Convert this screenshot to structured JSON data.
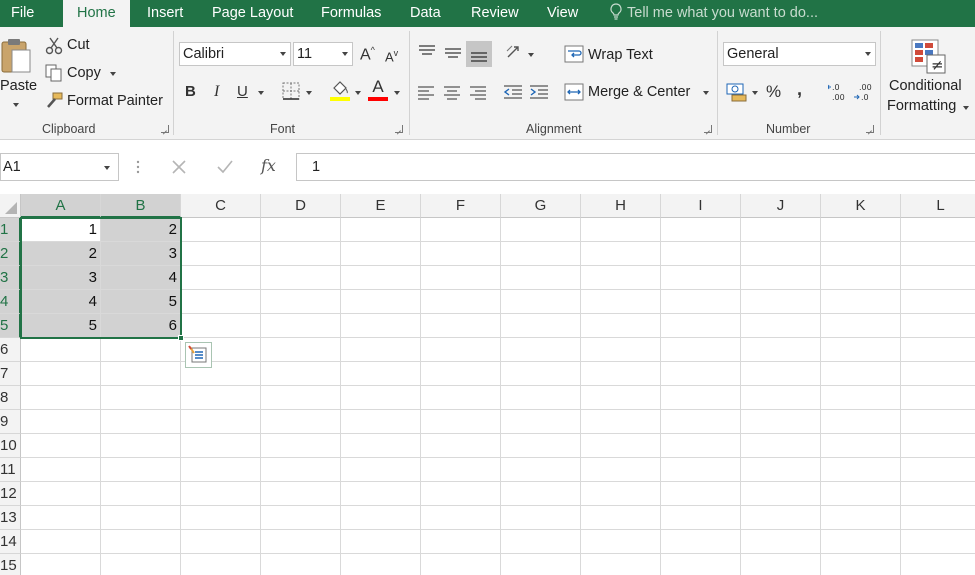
{
  "tabs": [
    {
      "label": "File"
    },
    {
      "label": "Home"
    },
    {
      "label": "Insert"
    },
    {
      "label": "Page Layout"
    },
    {
      "label": "Formulas"
    },
    {
      "label": "Data"
    },
    {
      "label": "Review"
    },
    {
      "label": "View"
    }
  ],
  "tell_me": "Tell me what you want to do...",
  "clipboard": {
    "paste": "Paste",
    "cut": "Cut",
    "copy": "Copy",
    "format_painter": "Format Painter",
    "label": "Clipboard"
  },
  "font": {
    "name": "Calibri",
    "size": "11",
    "bold": "B",
    "italic": "I",
    "underline": "U",
    "grow": "A",
    "shrink": "A",
    "font_color_letter": "A",
    "label": "Font"
  },
  "alignment": {
    "wrap_text": "Wrap Text",
    "merge_center": "Merge & Center",
    "label": "Alignment"
  },
  "number": {
    "format": "General",
    "percent": "%",
    "comma": ",",
    "label": "Number"
  },
  "styles": {
    "conditional_line1": "Conditional",
    "conditional_line2": "Formatting"
  },
  "formula_bar": {
    "name_box": "A1",
    "fx": "fx",
    "value": "1"
  },
  "columns": [
    "A",
    "B",
    "C",
    "D",
    "E",
    "F",
    "G",
    "H",
    "I",
    "J",
    "K",
    "L"
  ],
  "rows": [
    "1",
    "2",
    "3",
    "4",
    "5",
    "6",
    "7",
    "8",
    "9",
    "10",
    "11",
    "12",
    "13",
    "14",
    "15"
  ],
  "cells": [
    [
      "1",
      "2"
    ],
    [
      "2",
      "3"
    ],
    [
      "3",
      "4"
    ],
    [
      "4",
      "5"
    ],
    [
      "5",
      "6"
    ]
  ],
  "colors": {
    "accent": "#217346",
    "selection_fill": "#d2d2d2",
    "highlight_yellow": "#ffff00",
    "font_red": "#ff0000"
  }
}
